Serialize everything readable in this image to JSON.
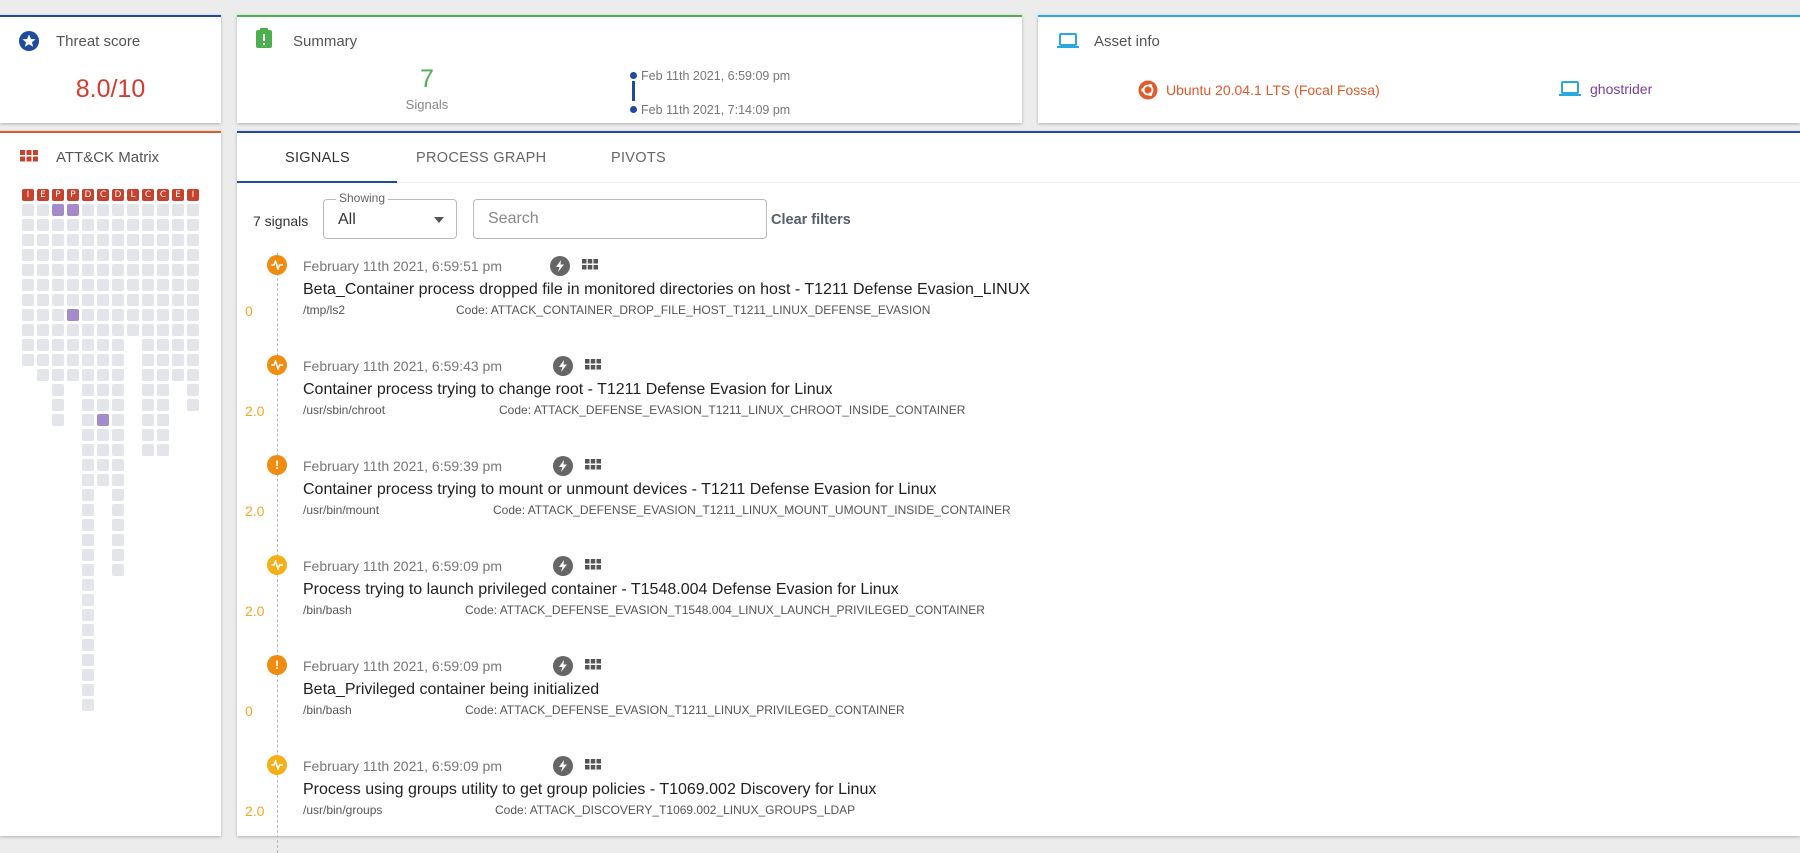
{
  "threat": {
    "title": "Threat score",
    "score": "8.0/10"
  },
  "summary": {
    "title": "Summary",
    "count": "7",
    "count_label": "Signals",
    "start_time": "Feb 11th 2021, 6:59:09 pm",
    "end_time": "Feb 11th 2021, 7:14:09 pm"
  },
  "asset": {
    "title": "Asset info",
    "os": "Ubuntu 20.04.1 LTS (Focal Fossa)",
    "hostname": "ghostrider"
  },
  "matrix": {
    "title": "ATT&CK Matrix",
    "headers": [
      "I",
      "E",
      "P",
      "P",
      "D",
      "C",
      "D",
      "L",
      "C",
      "C",
      "E",
      "I"
    ]
  },
  "tabs": [
    {
      "label": "SIGNALS",
      "active": true
    },
    {
      "label": "PROCESS GRAPH",
      "active": false
    },
    {
      "label": "PIVOTS",
      "active": false
    }
  ],
  "filters": {
    "signal_count": "7 signals",
    "showing_label": "Showing",
    "showing_value": "All",
    "search_placeholder": "Search",
    "clear_label": "Clear filters"
  },
  "signals": [
    {
      "score": "0",
      "badge": "pulse",
      "color": "orange",
      "time": "February 11th 2021, 6:59:51 pm",
      "title": "Beta_Container process dropped file in monitored directories on host - T1211 Defense Evasion_LINUX",
      "path": "/tmp/ls2",
      "code": "Code: ATTACK_CONTAINER_DROP_FILE_HOST_T1211_LINUX_DEFENSE_EVASION"
    },
    {
      "score": "2.0",
      "badge": "pulse",
      "color": "orange",
      "time": "February 11th 2021, 6:59:43 pm",
      "title": "Container process trying to change root - T1211 Defense Evasion for Linux",
      "path": "/usr/sbin/chroot",
      "code": "Code: ATTACK_DEFENSE_EVASION_T1211_LINUX_CHROOT_INSIDE_CONTAINER"
    },
    {
      "score": "2.0",
      "badge": "!",
      "color": "orange",
      "time": "February 11th 2021, 6:59:39 pm",
      "title": "Container process trying to mount or unmount devices - T1211 Defense Evasion for Linux",
      "path": "/usr/bin/mount",
      "code": "Code: ATTACK_DEFENSE_EVASION_T1211_LINUX_MOUNT_UMOUNT_INSIDE_CONTAINER"
    },
    {
      "score": "2.0",
      "badge": "pulse",
      "color": "yellow",
      "time": "February 11th 2021, 6:59:09 pm",
      "title": "Process trying to launch privileged container - T1548.004 Defense Evasion for Linux",
      "path": "/bin/bash",
      "code": "Code: ATTACK_DEFENSE_EVASION_T1548.004_LINUX_LAUNCH_PRIVILEGED_CONTAINER"
    },
    {
      "score": "0",
      "badge": "!",
      "color": "orange",
      "time": "February 11th 2021, 6:59:09 pm",
      "title": "Beta_Privileged container being initialized",
      "path": "/bin/bash",
      "code": "Code: ATTACK_DEFENSE_EVASION_T1211_LINUX_PRIVILEGED_CONTAINER"
    },
    {
      "score": "2.0",
      "badge": "pulse",
      "color": "yellow",
      "time": "February 11th 2021, 6:59:09 pm",
      "title": "Process using groups utility to get group policies - T1069.002 Discovery for Linux",
      "path": "/usr/bin/groups",
      "code": "Code: ATTACK_DISCOVERY_T1069.002_LINUX_GROUPS_LDAP"
    }
  ]
}
